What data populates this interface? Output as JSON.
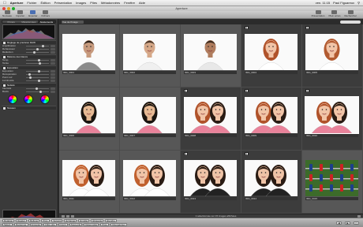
{
  "menubar": {
    "apple_icon": "apple-logo-icon",
    "app_name": "Aperture",
    "items": [
      "Fichier",
      "Édition",
      "Présentation",
      "Images",
      "Piles",
      "Métadonnées",
      "Fenêtre",
      "Aide"
    ],
    "clock": "ven. 11:15",
    "user": "Paul Figuareux"
  },
  "window": {
    "title": "Aperture",
    "close_color": "#e0443e",
    "min_color": "#dea123",
    "zoom_color": "#1aab29"
  },
  "toolbar": {
    "left_buttons": [
      "Nouveau",
      "Importer",
      "Exporter",
      "Fichiers"
    ],
    "right_buttons": [
      "Présentation",
      "Plein écran",
      "Rechercher"
    ]
  },
  "sidebar": {
    "tabs": [
      "Projets",
      "Métadonnées",
      "Ajustements"
    ],
    "sections": [
      {
        "label": "Réglage de précision RAW",
        "rows": [
          "Amplification",
          "Rehausseur",
          "Réduction"
        ]
      },
      {
        "label": "Balance des blancs",
        "rows": [
          "Temp.",
          "Teinte"
        ]
      },
      {
        "label": "Exposition",
        "rows": [
          "Exposition",
          "Récupération",
          "Point noir",
          "Luminosité"
        ]
      },
      {
        "label": "Netteté",
        "rows": [
          "Intensité",
          "Bords"
        ]
      },
      {
        "label": "Niveaux",
        "rows": []
      }
    ]
  },
  "browser": {
    "album_field": "Vue de l'image",
    "photos": [
      {
        "kind": "portrait",
        "bg": "#fafafa",
        "skin": "#c79a7d",
        "hair": "#2b2018",
        "shirt": "#8a8a8a",
        "name": "IMG_0001",
        "stars": 0,
        "selected": false,
        "stack": false
      },
      {
        "kind": "portrait",
        "bg": "#fafafa",
        "skin": "#d6a888",
        "hair": "#4a3526",
        "shirt": "#f0f0f0",
        "name": "IMG_0002",
        "stars": 0,
        "selected": false,
        "stack": false
      },
      {
        "kind": "portrait",
        "bg": "#fafafa",
        "skin": "#b07d5e",
        "hair": "#3b2a1d",
        "shirt": "#e8e8e8",
        "name": "IMG_0003",
        "stars": 0,
        "selected": false,
        "stack": false
      },
      {
        "kind": "girl",
        "bg": "#fafafa",
        "skin": "#f1c4a7",
        "hair": "#b0522a",
        "shirt": "#ffffff",
        "name": "IMG_0004",
        "stars": 0,
        "selected": false,
        "stack": true
      },
      {
        "kind": "girl",
        "bg": "#fafafa",
        "skin": "#f1c4a7",
        "hair": "#b25a30",
        "shirt": "#ffffff",
        "name": "IMG_0005",
        "stars": 0,
        "selected": false,
        "stack": true
      },
      {
        "kind": "child",
        "bg": "#fafafa",
        "skin": "#e6b993",
        "hair": "#1a140f",
        "shirt": "#e9829a",
        "name": "IMG_0006",
        "stars": 0,
        "selected": false,
        "stack": false
      },
      {
        "kind": "child",
        "bg": "#fafafa",
        "skin": "#e6b993",
        "hair": "#1a140f",
        "shirt": "#e9829a",
        "name": "IMG_0007",
        "stars": 0,
        "selected": false,
        "stack": false
      },
      {
        "kind": "pair",
        "bg": "#fafafa",
        "skin": "#f1c4a7",
        "hair": "#b0522a",
        "shirt": "#e9829a",
        "name": "IMG_0008",
        "stars": 0,
        "selected": false,
        "stack": true
      },
      {
        "kind": "pair",
        "bg": "#fafafa",
        "skin": "#f1c4a7",
        "hair": "#b0522a",
        "shirt": "#e9829a",
        "name": "IMG_0009",
        "stars": 0,
        "selected": false,
        "stack": true
      },
      {
        "kind": "pair",
        "bg": "#fafafa",
        "skin": "#f1c4a7",
        "hair": "#b0522a",
        "shirt": "#e9829a",
        "name": "IMG_0010",
        "stars": 0,
        "selected": true,
        "stack": true
      },
      {
        "kind": "pair",
        "bg": "#fafafa",
        "skin": "#f1c4a7",
        "hair": "#c0602e",
        "shirt": "#ffffff",
        "name": "IMG_0011",
        "stars": 0,
        "selected": false,
        "stack": false
      },
      {
        "kind": "pair",
        "bg": "#fafafa",
        "skin": "#f1c4a7",
        "hair": "#c0602e",
        "shirt": "#ffffff",
        "name": "IMG_0012",
        "stars": 0,
        "selected": false,
        "stack": false
      },
      {
        "kind": "dark",
        "bg": "#fafafa",
        "skin": "#efc3a6",
        "hair": "#2a1c14",
        "shirt": "#222222",
        "name": "IMG_0013",
        "stars": 0,
        "selected": false,
        "stack": true
      },
      {
        "kind": "dark",
        "bg": "#fafafa",
        "skin": "#efc3a6",
        "hair": "#2a1c14",
        "shirt": "#222222",
        "name": "IMG_0014",
        "stars": 0,
        "selected": false,
        "stack": true
      },
      {
        "kind": "foosball",
        "bg": "#3c6b2a",
        "skin": "#cc2222",
        "hair": "#1d3f8c",
        "shirt": "#e2e2e2",
        "name": "IMG_0015",
        "stars": 0,
        "selected": false,
        "stack": false
      }
    ]
  },
  "statusbar": {
    "info": "1 sélectionnée sur 15 images affichées"
  },
  "buttonbar": {
    "row1": [
      "Rotation",
      "Rejeter",
      "Refuser",
      "Préc.",
      "Suivant",
      "Échange",
      "Empiler",
      "Étiquette",
      "Étendre"
    ],
    "row2": [
      "Sélect.",
      "Retourner",
      "Accepter",
      "Filtre pile",
      "Ouvrir",
      "Sous-pile",
      "Désempiler",
      "Prés.",
      "Réorganiser"
    ]
  }
}
